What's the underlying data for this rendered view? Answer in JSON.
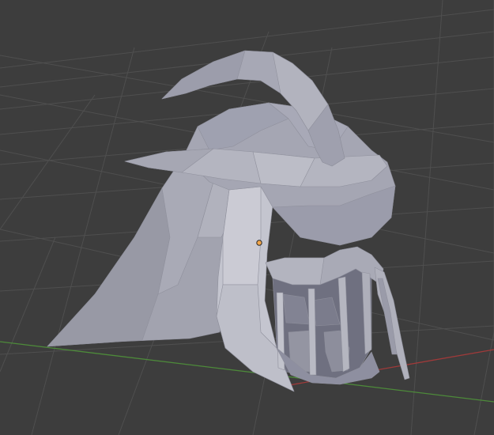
{
  "viewport": {
    "background_color": "#3d3d3d",
    "grid_color": "#4f4f4f",
    "x_axis_color": "#a03a3a",
    "y_axis_color": "#4d8a3a"
  },
  "scene": {
    "object_type": "helmet-mesh",
    "shading": "solid",
    "object_color": "#a9aab6",
    "origin_color": "#f3a64a",
    "selected": false
  }
}
